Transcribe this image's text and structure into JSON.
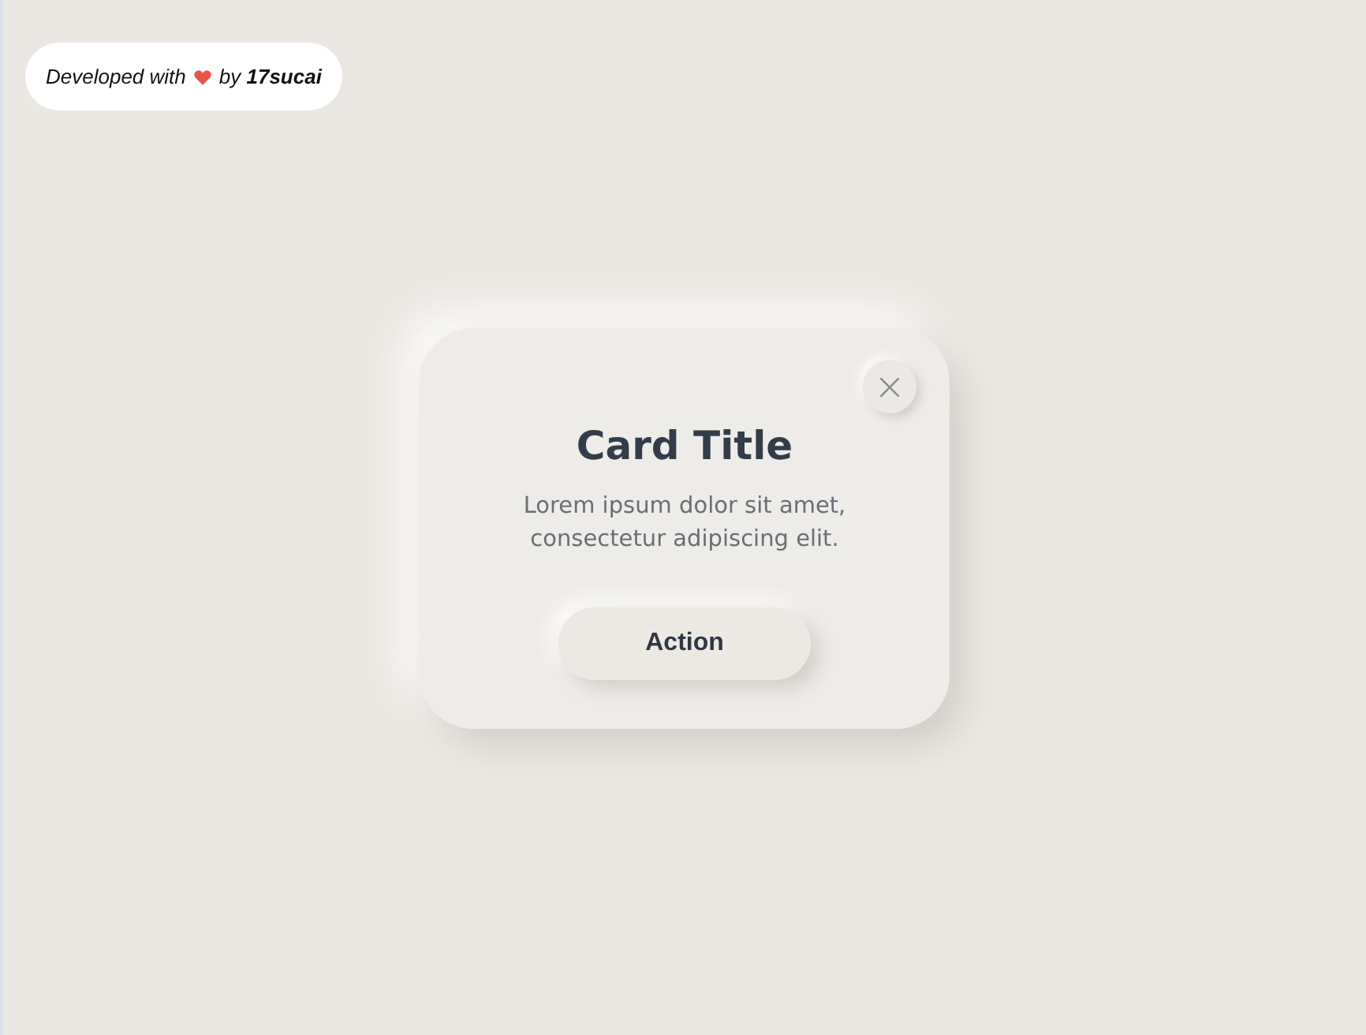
{
  "credit": {
    "prefix": "Developed with",
    "suffix": "by **17sucai**"
  },
  "card": {
    "close": "×",
    "title": "Card Title",
    "text": "Lorem ipsum dolor sit amet, consectetur adipiscing elit.",
    "action": "Action"
  }
}
